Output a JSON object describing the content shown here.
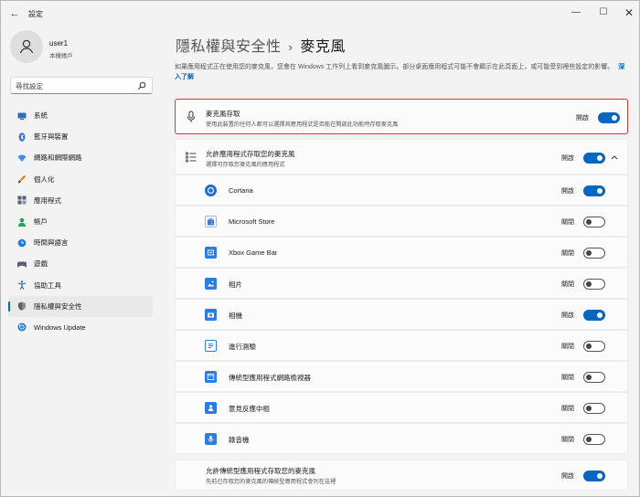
{
  "window": {
    "back_glyph": "←",
    "title": "設定",
    "minimize": "—",
    "maximize": "☐",
    "close": "✕"
  },
  "user": {
    "name": "user1",
    "account": "本機帳戶"
  },
  "search": {
    "placeholder": "尋找設定"
  },
  "nav": [
    {
      "label": "系統",
      "icon": "system-icon",
      "color": "#2c6cc6"
    },
    {
      "label": "藍牙與裝置",
      "icon": "bluetooth-icon",
      "color": "#1b62d1"
    },
    {
      "label": "網路和網際網路",
      "icon": "wifi-icon",
      "color": "#3a8fe0"
    },
    {
      "label": "個人化",
      "icon": "brush-icon",
      "color": "#d98c2c"
    },
    {
      "label": "應用程式",
      "icon": "apps-icon",
      "color": "#556070"
    },
    {
      "label": "帳戶",
      "icon": "person-icon",
      "color": "#29a35a"
    },
    {
      "label": "時間與語言",
      "icon": "globe-clock-icon",
      "color": "#1f7ad6"
    },
    {
      "label": "遊戲",
      "icon": "gamepad-icon",
      "color": "#556070"
    },
    {
      "label": "協助工具",
      "icon": "accessibility-icon",
      "color": "#1b62d1"
    },
    {
      "label": "隱私權與安全性",
      "icon": "shield-icon",
      "color": "#7a7a7a",
      "active": true
    },
    {
      "label": "Windows Update",
      "icon": "update-icon",
      "color": "#1f7ad6"
    }
  ],
  "page": {
    "breadcrumb": "隱私權與安全性",
    "separator": "›",
    "title": "麥克風",
    "description": "如果應用程式正在使用您的麥克風，您會在 Windows 工作列上看到麥克風圖示。部分桌面應用程式可能不會顯示在此頁面上，或可能受到裡些設定的影響。",
    "learn_more": "深入了解"
  },
  "mic_access": {
    "title": "麥克風存取",
    "subtitle": "使用此裝置的任何人都可以選擇其應用程式是否能在開啟此功能時存取麥克風",
    "state": "開啟",
    "on": true
  },
  "app_access": {
    "title": "允許應用程式存取您的麥克風",
    "subtitle": "選擇可存取您麥克風的應用程式",
    "state": "開啟",
    "on": true
  },
  "apps": [
    {
      "name": "Cortana",
      "state": "開啟",
      "on": true,
      "icon": "cortana-icon",
      "color": "#1b6ed6"
    },
    {
      "name": "Microsoft Store",
      "state": "關閉",
      "on": false,
      "icon": "store-icon",
      "color": "#2a7de1"
    },
    {
      "name": "Xbox Game Bar",
      "state": "關閉",
      "on": false,
      "icon": "xbox-icon",
      "color": "#2a7de1"
    },
    {
      "name": "相片",
      "state": "關閉",
      "on": false,
      "icon": "photos-icon",
      "color": "#2a7de1"
    },
    {
      "name": "相機",
      "state": "開啟",
      "on": true,
      "icon": "camera-icon",
      "color": "#2a7de1"
    },
    {
      "name": "進行測驗",
      "state": "關閉",
      "on": false,
      "icon": "quiz-icon",
      "color": "#2a7de1"
    },
    {
      "name": "傳統型應用程式網路檢視器",
      "state": "關閉",
      "on": false,
      "icon": "webview-icon",
      "color": "#2a7de1"
    },
    {
      "name": "意見反應中樞",
      "state": "關閉",
      "on": false,
      "icon": "feedback-icon",
      "color": "#2a7de1"
    },
    {
      "name": "錄音機",
      "state": "關閉",
      "on": false,
      "icon": "recorder-icon",
      "color": "#2a7de1"
    }
  ],
  "desktop_access": {
    "title": "允許傳統型應用程式存取您的麥克風",
    "subtitle": "先前已存取您的麥克風的傳統型應用程式會列在這裡",
    "state": "開啟",
    "on": true
  }
}
